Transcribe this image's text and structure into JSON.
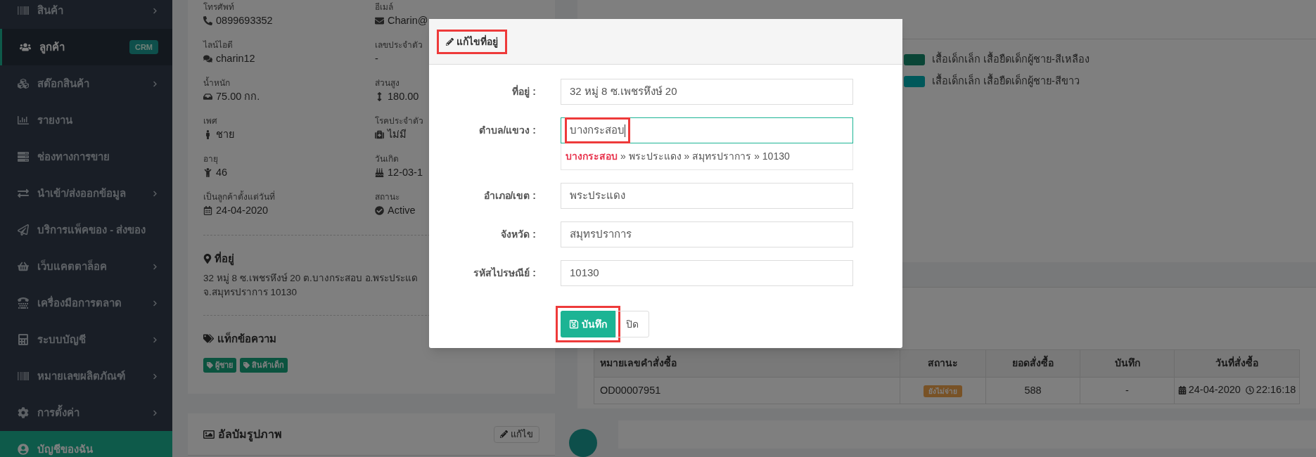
{
  "sidebar": {
    "items": [
      {
        "label": "สินค้า",
        "selected": false,
        "has_submenu": true
      },
      {
        "label": "ลูกค้า",
        "selected": true,
        "has_submenu": false,
        "badge": "CRM"
      },
      {
        "label": "สต๊อกสินค้า",
        "selected": false,
        "has_submenu": true
      },
      {
        "label": "รายงาน",
        "selected": false,
        "has_submenu": false
      },
      {
        "label": "ช่องทางการขาย",
        "selected": false,
        "has_submenu": false
      },
      {
        "label": "นำเข้า/ส่งออกข้อมูล",
        "selected": false,
        "has_submenu": true
      },
      {
        "label": "บริการแพ็คของ - ส่งของ",
        "selected": false,
        "has_submenu": false
      },
      {
        "label": "เว็บแคตตาล็อค",
        "selected": false,
        "has_submenu": true
      },
      {
        "label": "เครื่องมือการตลาด",
        "selected": false,
        "has_submenu": true
      },
      {
        "label": "ระบบบัญชี",
        "selected": false,
        "has_submenu": true
      },
      {
        "label": "หมายเลขผลิตภัณฑ์",
        "selected": false,
        "has_submenu": true
      },
      {
        "label": "การตั้งค่า",
        "selected": false,
        "has_submenu": true
      }
    ],
    "account_item": {
      "label": "บัญชีของฉัน"
    }
  },
  "customer": {
    "fields": [
      {
        "label": "โทรศัพท์",
        "value": "0899693352"
      },
      {
        "label": "อีเมล์",
        "value": "Charin@"
      },
      {
        "label": "ไลน์ไอดี",
        "value": "charin12"
      },
      {
        "label": "เลขประจำตัว",
        "value": "-"
      },
      {
        "label": "น้ำหนัก",
        "value": "75.00 กก."
      },
      {
        "label": "ส่วนสูง",
        "value": "180.00"
      },
      {
        "label": "เพศ",
        "value": "ชาย"
      },
      {
        "label": "โรคประจำตัว",
        "value": "ไม่มี"
      },
      {
        "label": "อายุ",
        "value": "46"
      },
      {
        "label": "วันเกิด",
        "value": "12-03-1"
      },
      {
        "label": "เป็นลูกค้าตั้งแต่วันที่",
        "value": "24-04-2020"
      },
      {
        "label": "สถานะ",
        "value": "Active"
      }
    ],
    "address_title": "ที่อยู่",
    "address_lines": [
      "32 หมู่ 8 ซ.เพชรหึงษ์ 20 ต.บางกระสอบ อ.พระประแด",
      "จ.สมุทรปราการ 10130"
    ],
    "tags_title": "แท็กข้อความ",
    "tags": [
      "ผู้ชาย",
      "สินค้าเด็ก"
    ]
  },
  "album": {
    "title": "อัลบัมรูปภาพ",
    "edit_button": "แก้ไข"
  },
  "products_legend": [
    {
      "label": "เสื้อเด็กเล็ก เสื้อยืดเด็กผู้ชาย-สีเหลือง",
      "color": "#0a4536"
    },
    {
      "label": "เสื้อเด็กเล็ก เสื้อยืดเด็กผู้ชาย-สีขาว",
      "color": "#00585a"
    }
  ],
  "orders": {
    "columns": [
      "หมายเลขคำสั่งซื้อ",
      "สถานะ",
      "ยอดสั่งซื้อ",
      "บันทึก",
      "วันที่สั่งซื้อ"
    ],
    "rows": [
      {
        "order_no": "OD00007951",
        "status": "ยังไม่จ่าย",
        "total": "588",
        "note": "-",
        "date": "24-04-2020",
        "time": "22:16:18"
      }
    ]
  },
  "modal": {
    "title": "แก้ไขที่อยู่",
    "title_highlighted": true,
    "fields": [
      {
        "label": "ที่อยู่ :",
        "value": "32 หมู่ 8 ซ.เพชรหึงษ์ 20",
        "focused": false,
        "highlighted": false
      },
      {
        "label": "ตำบล/แขวง :",
        "value": "บางกระสอบ",
        "focused": true,
        "highlighted": true,
        "suggestion": "**บางกระสอบ** » พระประแดง » สมุทรปราการ » 10130"
      },
      {
        "label": "อำเภอ/เขต :",
        "value": "พระประแดง",
        "focused": false,
        "highlighted": false
      },
      {
        "label": "จังหวัด :",
        "value": "สมุทรปราการ",
        "focused": false,
        "highlighted": false
      },
      {
        "label": "รหัสไปรษณีย์ :",
        "value": "10130",
        "focused": false,
        "highlighted": false
      }
    ],
    "save_button": "บันทึก",
    "save_highlighted": true,
    "close_button": "ปิด"
  }
}
